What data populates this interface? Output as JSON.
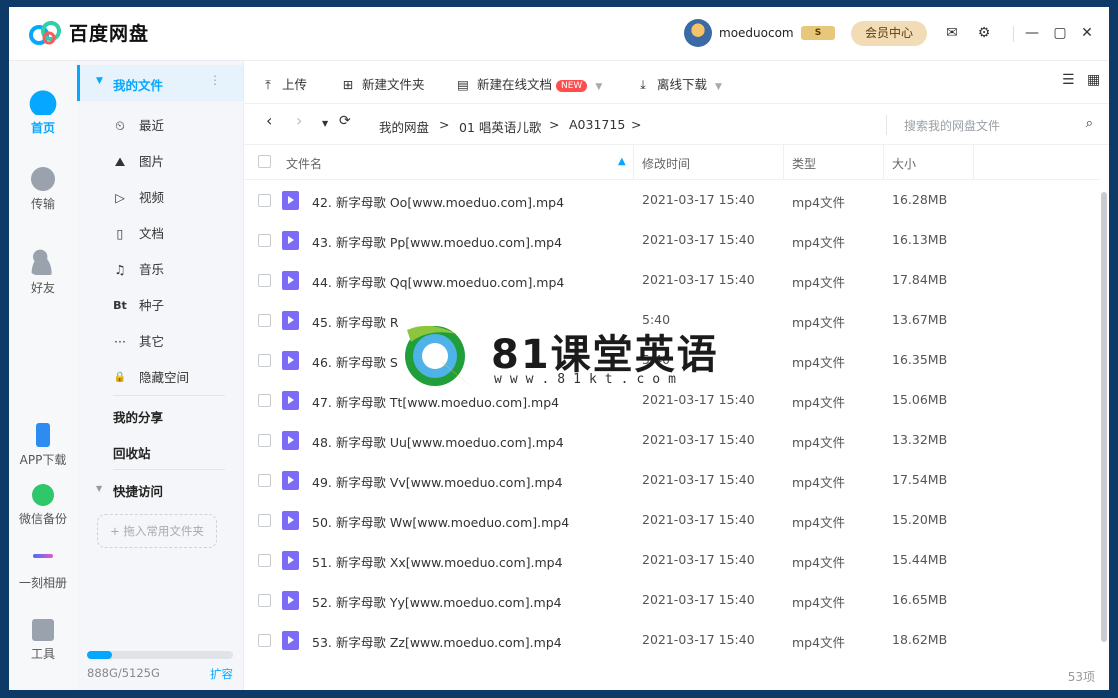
{
  "app": {
    "name": "百度网盘",
    "username": "moeduocom",
    "vip_badge": "S",
    "vip_center": "会员中心"
  },
  "rail": {
    "items": [
      {
        "label": "首页",
        "icon": "cloud-icon"
      },
      {
        "label": "传输",
        "icon": "transfer-icon"
      },
      {
        "label": "好友",
        "icon": "friends-icon"
      },
      {
        "label": "APP下载",
        "icon": "phone-icon"
      },
      {
        "label": "微信备份",
        "icon": "wechat-icon"
      },
      {
        "label": "一刻相册",
        "icon": "album-icon"
      },
      {
        "label": "工具",
        "icon": "tools-icon"
      }
    ]
  },
  "sidebar": {
    "my_files": "我的文件",
    "items": [
      {
        "label": "最近",
        "icon": "⏲"
      },
      {
        "label": "图片",
        "icon": "⛰"
      },
      {
        "label": "视频",
        "icon": "▷"
      },
      {
        "label": "文档",
        "icon": "▯"
      },
      {
        "label": "音乐",
        "icon": "♫"
      },
      {
        "label": "种子",
        "icon": "Bt"
      },
      {
        "label": "其它",
        "icon": "···"
      },
      {
        "label": "隐藏空间",
        "icon": "🔒"
      }
    ],
    "my_share": "我的分享",
    "recycle": "回收站",
    "quick_access": "快捷访问",
    "drop_hint": "+ 拖入常用文件夹",
    "quota_text": "888G/5125G",
    "quota_used_fraction": 0.173,
    "expand": "扩容"
  },
  "toolbar": {
    "upload": "上传",
    "new_folder": "新建文件夹",
    "new_doc": "新建在线文档",
    "new_badge": "NEW",
    "offline": "离线下载"
  },
  "breadcrumb": {
    "root": "我的网盘",
    "folder1": "01 唱英语儿歌",
    "folder2": "A031715",
    "sep": ">"
  },
  "search": {
    "placeholder": "搜索我的网盘文件"
  },
  "table": {
    "headers": {
      "name": "文件名",
      "mtime": "修改时间",
      "type": "类型",
      "size": "大小"
    },
    "rows": [
      {
        "name": "42. 新字母歌 Oo[www.moeduo.com].mp4",
        "mtime": "2021-03-17 15:40",
        "type": "mp4文件",
        "size": "16.28MB"
      },
      {
        "name": "43. 新字母歌 Pp[www.moeduo.com].mp4",
        "mtime": "2021-03-17 15:40",
        "type": "mp4文件",
        "size": "16.13MB"
      },
      {
        "name": "44. 新字母歌 Qq[www.moeduo.com].mp4",
        "mtime": "2021-03-17 15:40",
        "type": "mp4文件",
        "size": "17.84MB"
      },
      {
        "name": "45. 新字母歌 R",
        "mtime": "5:40",
        "type": "mp4文件",
        "size": "13.67MB"
      },
      {
        "name": "46. 新字母歌 S",
        "mtime": "5:40",
        "type": "mp4文件",
        "size": "16.35MB"
      },
      {
        "name": "47. 新字母歌 Tt[www.moeduo.com].mp4",
        "mtime": "2021-03-17 15:40",
        "type": "mp4文件",
        "size": "15.06MB"
      },
      {
        "name": "48. 新字母歌 Uu[www.moeduo.com].mp4",
        "mtime": "2021-03-17 15:40",
        "type": "mp4文件",
        "size": "13.32MB"
      },
      {
        "name": "49. 新字母歌 Vv[www.moeduo.com].mp4",
        "mtime": "2021-03-17 15:40",
        "type": "mp4文件",
        "size": "17.54MB"
      },
      {
        "name": "50. 新字母歌 Ww[www.moeduo.com].mp4",
        "mtime": "2021-03-17 15:40",
        "type": "mp4文件",
        "size": "15.20MB"
      },
      {
        "name": "51. 新字母歌 Xx[www.moeduo.com].mp4",
        "mtime": "2021-03-17 15:40",
        "type": "mp4文件",
        "size": "15.44MB"
      },
      {
        "name": "52. 新字母歌 Yy[www.moeduo.com].mp4",
        "mtime": "2021-03-17 15:40",
        "type": "mp4文件",
        "size": "16.65MB"
      },
      {
        "name": "53. 新字母歌 Zz[www.moeduo.com].mp4",
        "mtime": "2021-03-17 15:40",
        "type": "mp4文件",
        "size": "18.62MB"
      }
    ]
  },
  "footer": {
    "count": "53项"
  },
  "watermark": {
    "title": "81课堂英语",
    "url": "www.81kt.com"
  },
  "colors": {
    "accent": "#06a7ff",
    "file_icon": "#7c6cf5",
    "new_badge": "#ff4c4c",
    "vip": "#f2dcb6"
  }
}
